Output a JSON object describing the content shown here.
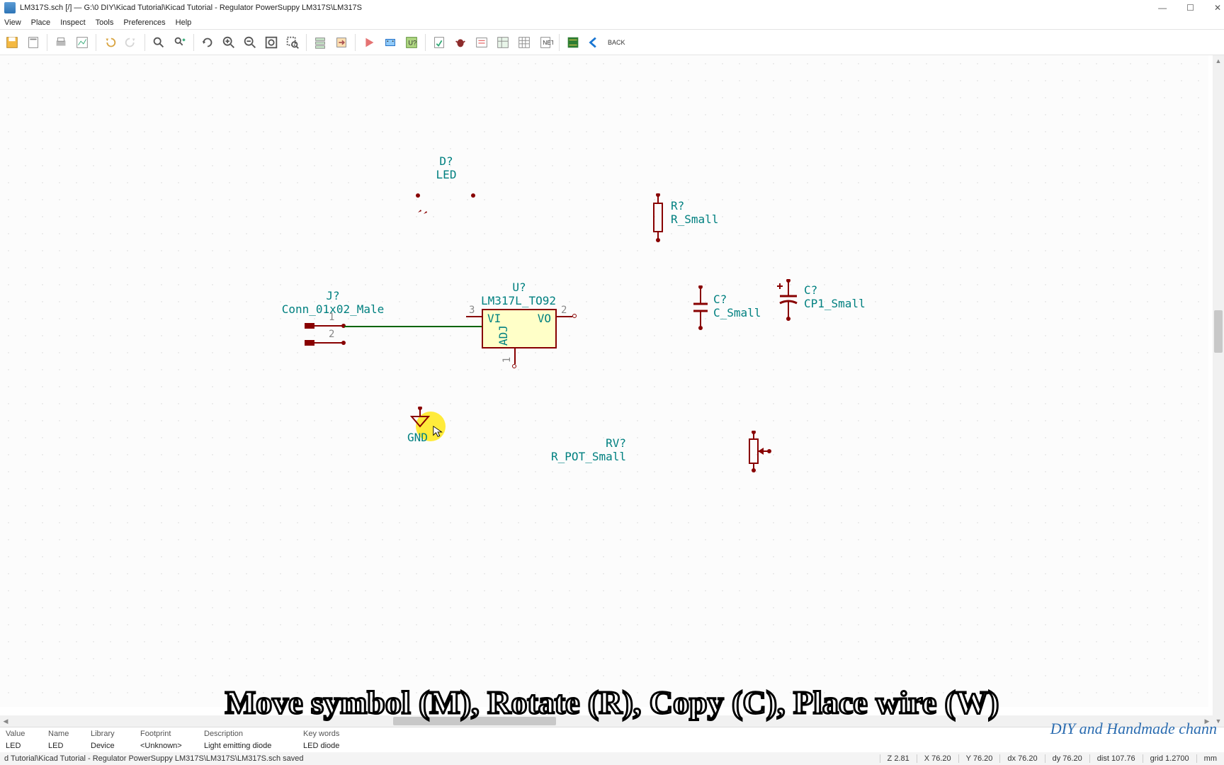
{
  "window": {
    "title": "LM317S.sch [/] — G:\\0 DIY\\Kicad Tutorial\\Kicad Tutorial - Regulator PowerSuppy LM317S\\LM317S"
  },
  "menu": {
    "view": "View",
    "place": "Place",
    "inspect": "Inspect",
    "tools": "Tools",
    "preferences": "Preferences",
    "help": "Help"
  },
  "toolbar": {
    "back": "BACK"
  },
  "components": {
    "led": {
      "ref": "D?",
      "value": "LED"
    },
    "resistor": {
      "ref": "R?",
      "value": "R_Small"
    },
    "conn": {
      "ref": "J?",
      "value": "Conn_01x02_Male",
      "pin1": "1",
      "pin2": "2"
    },
    "reg": {
      "ref": "U?",
      "value": "LM317L_TO92",
      "pin_vi_num": "3",
      "pin_vi": "VI",
      "pin_vo_num": "2",
      "pin_vo": "VO",
      "pin_adj": "ADJ",
      "pin_adj_num": "1"
    },
    "cap": {
      "ref": "C?",
      "value": "C_Small"
    },
    "cap_pol": {
      "ref": "C?",
      "value": "CP1_Small"
    },
    "gnd": {
      "label": "GND"
    },
    "pot": {
      "ref": "RV?",
      "value": "R_POT_Small"
    }
  },
  "overlay": {
    "text": "Move symbol (M), Rotate (R), Copy (C), Place wire (W)",
    "channel": "DIY and Handmade chann"
  },
  "info": {
    "headers": {
      "c0": "Value",
      "c1": "Name",
      "c2": "Library",
      "c3": "Footprint",
      "c4": "Description",
      "c5": "Key words"
    },
    "values": {
      "c0": "LED",
      "c1": "LED",
      "c2": "Device",
      "c3": "<Unknown>",
      "c4": "Light emitting diode",
      "c5": "LED diode"
    }
  },
  "status": {
    "msg": "d Tutorial\\Kicad Tutorial - Regulator PowerSuppy LM317S\\LM317S\\LM317S.sch saved",
    "z": "Z 2.81",
    "x": "X 76.20",
    "y": "Y 76.20",
    "dx": "dx 76.20",
    "dy": "dy 76.20",
    "dist": "dist 107.76",
    "grid": "grid 1.2700",
    "unit": "mm"
  }
}
